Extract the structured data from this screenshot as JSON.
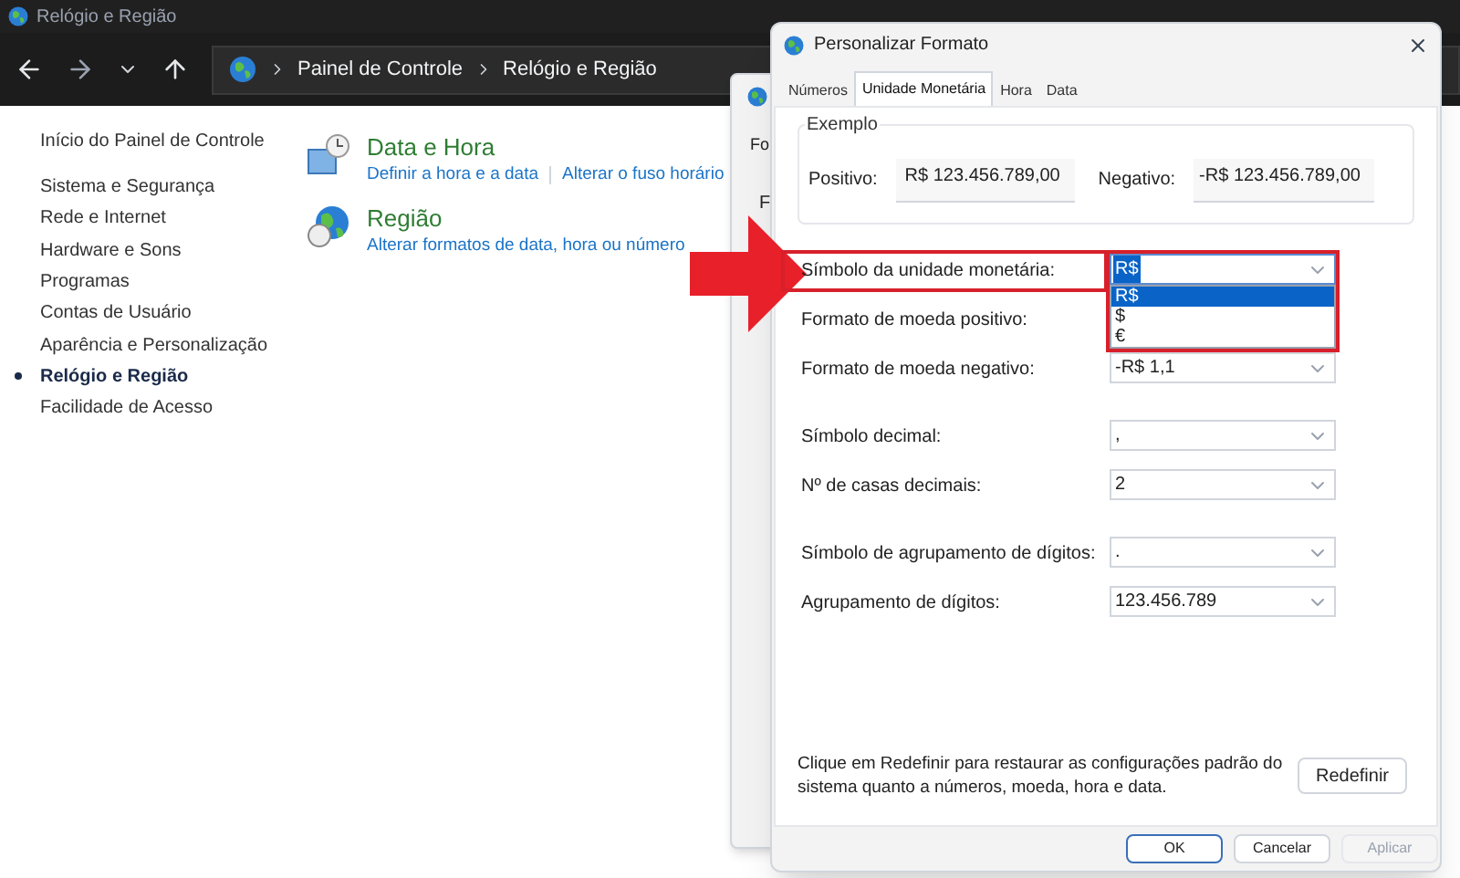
{
  "window": {
    "title": "Relógio e Região"
  },
  "breadcrumb": [
    "Painel de Controle",
    "Relógio e Região"
  ],
  "sidebar": {
    "home": "Início do Painel de Controle",
    "items": [
      {
        "label": "Sistema e Segurança",
        "selected": false
      },
      {
        "label": "Rede e Internet",
        "selected": false
      },
      {
        "label": "Hardware e Sons",
        "selected": false
      },
      {
        "label": "Programas",
        "selected": false
      },
      {
        "label": "Contas de Usuário",
        "selected": false
      },
      {
        "label": "Aparência e Personalização",
        "selected": false
      },
      {
        "label": "Relógio e Região",
        "selected": true
      },
      {
        "label": "Facilidade de Acesso",
        "selected": false
      }
    ]
  },
  "categories": [
    {
      "kind": "clock",
      "title": "Data e Hora",
      "links": [
        "Definir a hora e a data",
        "Alterar o fuso horário"
      ]
    },
    {
      "kind": "globe",
      "title": "Região",
      "links": [
        "Alterar formatos de data, hora ou número"
      ]
    }
  ],
  "back_dialog": {
    "texts": [
      "Fo",
      "F"
    ]
  },
  "dialog": {
    "title": "Personalizar Formato",
    "tabs": [
      {
        "label": "Números",
        "selected": false
      },
      {
        "label": "Unidade Monetária",
        "selected": true
      },
      {
        "label": "Hora",
        "selected": false
      },
      {
        "label": "Data",
        "selected": false
      }
    ],
    "example": {
      "legend": "Exemplo",
      "positive_label": "Positivo:",
      "positive_value": "R$ 123.456.789,00",
      "negative_label": "Negativo:",
      "negative_value": "-R$ 123.456.789,00"
    },
    "field_groups": [
      [
        {
          "label": "Símbolo da unidade monetária:",
          "value": "R$",
          "highlighted": true,
          "expanded": true,
          "options": [
            {
              "label": "R$",
              "selected": true
            },
            {
              "label": "$",
              "selected": false
            },
            {
              "label": "€",
              "selected": false
            }
          ]
        },
        {
          "label": "Formato de moeda positivo:",
          "highlighted": false,
          "expanded": false
        },
        {
          "label": "Formato de moeda negativo:",
          "value": "-R$ 1,1",
          "highlighted": false,
          "expanded": false
        }
      ],
      [
        {
          "label": "Símbolo decimal:",
          "value": ",",
          "highlighted": false,
          "expanded": false
        },
        {
          "label": "Nº de casas decimais:",
          "value": "2",
          "highlighted": false,
          "expanded": false
        }
      ],
      [
        {
          "label": "Símbolo de agrupamento de dígitos:",
          "value": ".",
          "highlighted": false,
          "expanded": false
        },
        {
          "label": "Agrupamento de dígitos:",
          "value": "123.456.789",
          "highlighted": false,
          "expanded": false
        }
      ]
    ],
    "note": "Clique em Redefinir para restaurar as configurações padrão do sistema quanto a números, moeda, hora e data.",
    "reset_button": "Redefinir",
    "buttons": [
      {
        "label": "OK",
        "default": true,
        "disabled": false
      },
      {
        "label": "Cancelar",
        "default": false,
        "disabled": false
      },
      {
        "label": "Aplicar",
        "default": false,
        "disabled": true
      }
    ]
  }
}
